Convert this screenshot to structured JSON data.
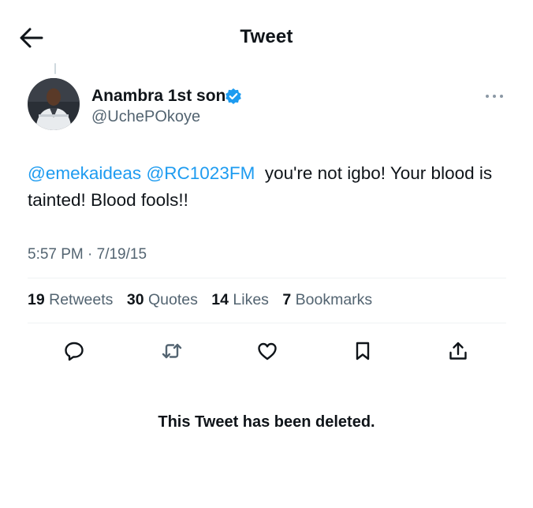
{
  "header": {
    "title": "Tweet",
    "back_icon": "arrow-left-icon"
  },
  "tweet": {
    "author": {
      "display_name": "Anambra 1st son",
      "handle": "@UchePOkoye",
      "verified_color": "#1d9bf0",
      "avatar": "avatar"
    },
    "text_parts": {
      "mention1": "@emekaideas",
      "mention2": "@RC1023FM",
      "body": "you're not igbo! Your blood is tainted! Blood fools!!"
    },
    "timestamp": "5:57 PM · 7/19/15",
    "stats": {
      "retweets": {
        "count": "19",
        "label": "Retweets"
      },
      "quotes": {
        "count": "30",
        "label": "Quotes"
      },
      "likes": {
        "count": "14",
        "label": "Likes"
      },
      "bookmarks": {
        "count": "7",
        "label": "Bookmarks"
      }
    },
    "actions": [
      "reply-icon",
      "retweet-icon",
      "like-icon",
      "bookmark-icon",
      "share-icon"
    ]
  },
  "notice": "This Tweet has been deleted.",
  "colors": {
    "accent": "#1d9bf0",
    "text": "#0f1419",
    "muted": "#536471",
    "divider": "#eff3f4"
  }
}
